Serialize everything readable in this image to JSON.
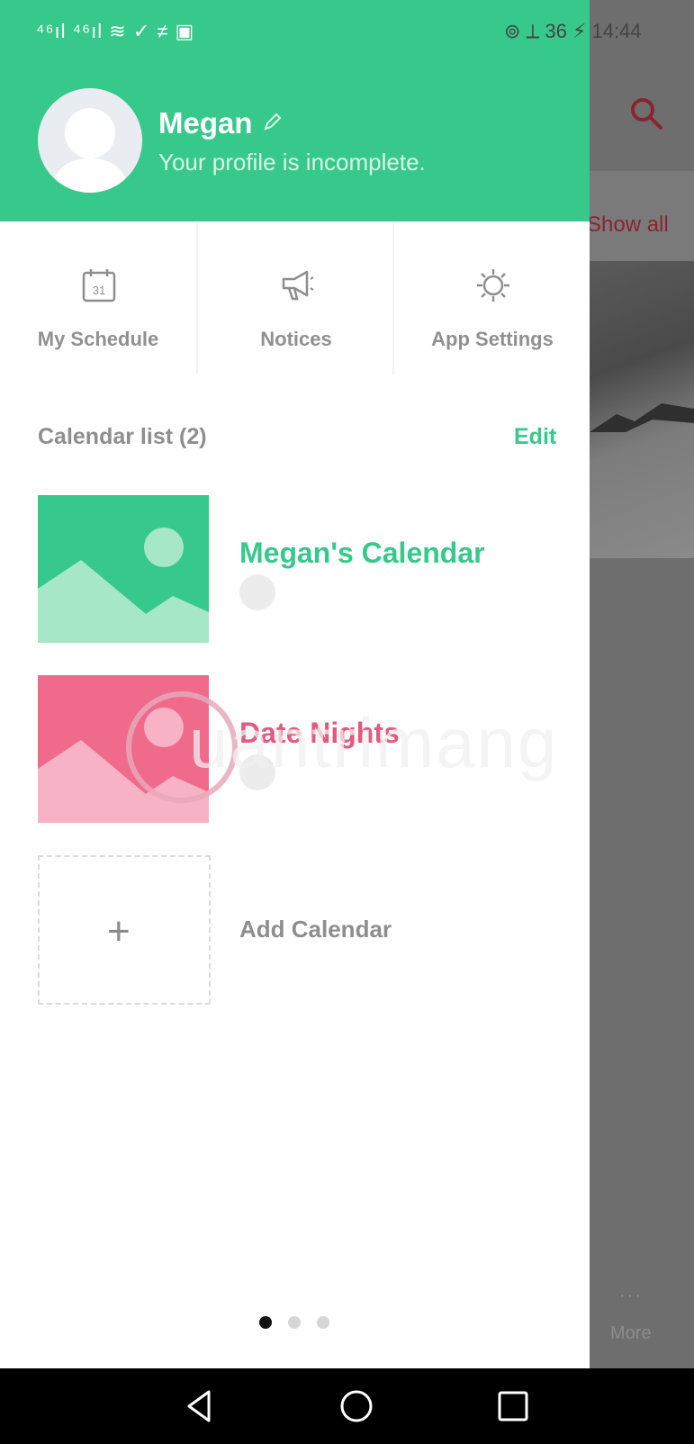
{
  "status_bar": {
    "left_icons": "⁴⁶ıl ⁴⁶ıl ≋ ✓ ≠ ▣",
    "right_text": "⊚ ⟂ 36 ⚡ 14:44"
  },
  "background_app": {
    "show_all": "Show all",
    "more": "More",
    "dots": "···"
  },
  "profile": {
    "name": "Megan",
    "subtitle": "Your profile is incomplete."
  },
  "quick_actions": [
    {
      "label": "My Schedule",
      "icon": "calendar-icon",
      "icon_text": "31"
    },
    {
      "label": "Notices",
      "icon": "megaphone-icon"
    },
    {
      "label": "App Settings",
      "icon": "gear-icon"
    }
  ],
  "calendar_list": {
    "title": "Calendar list (2)",
    "edit_label": "Edit",
    "items": [
      {
        "name": "Megan's Calendar",
        "color": "#37c98b",
        "thumb_light": "#a6e7c8"
      },
      {
        "name": "Date Nights",
        "color": "#f06a8c",
        "thumb_light": "#f7b2c6"
      }
    ],
    "add_label": "Add Calendar",
    "add_plus": "+"
  },
  "watermark": {
    "text": "uantrimang"
  },
  "pager": {
    "total": 3,
    "active": 0
  }
}
